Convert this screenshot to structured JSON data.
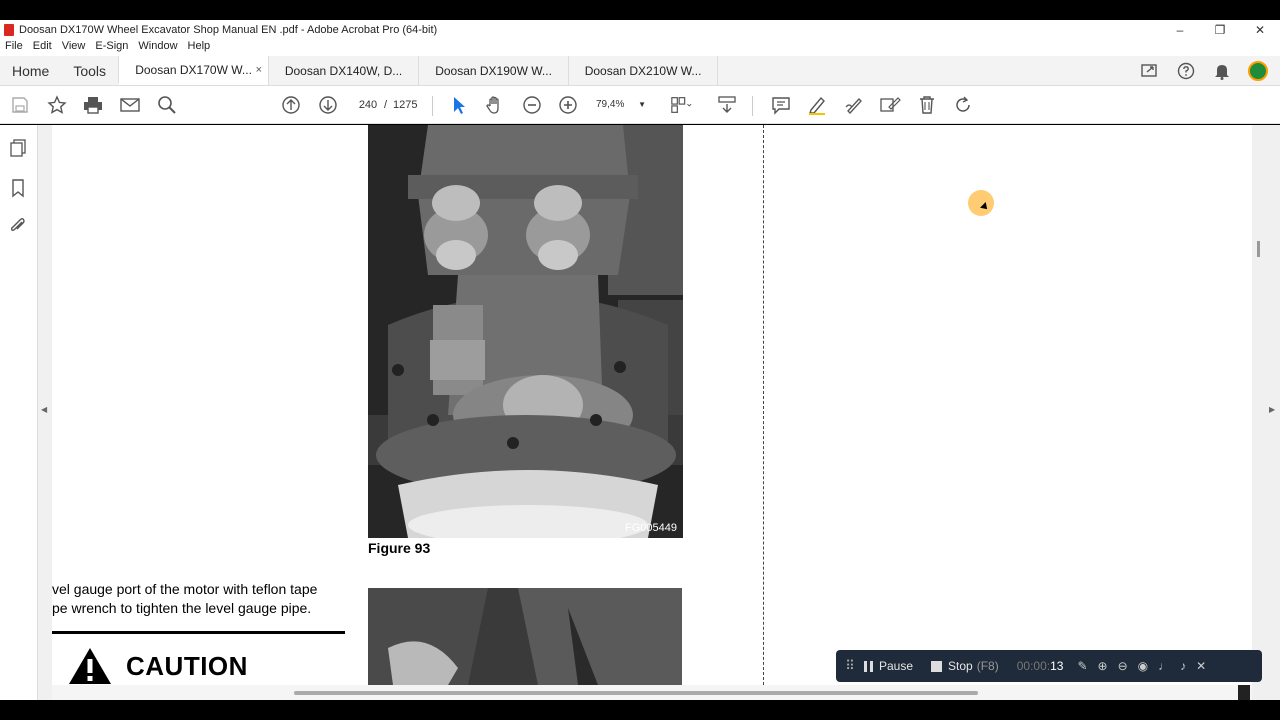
{
  "window": {
    "title": "Doosan DX170W Wheel Excavator Shop Manual EN .pdf - Adobe Acrobat Pro (64-bit)",
    "controls": [
      "–",
      "❐",
      "✕"
    ]
  },
  "menu": [
    "File",
    "Edit",
    "View",
    "E-Sign",
    "Window",
    "Help"
  ],
  "tabs": {
    "home": "Home",
    "tools": "Tools",
    "documents": [
      {
        "label": "Doosan DX170W W...",
        "active": true,
        "close": "×"
      },
      {
        "label": "Doosan DX140W, D..."
      },
      {
        "label": "Doosan DX190W W..."
      },
      {
        "label": "Doosan DX210W W..."
      }
    ]
  },
  "toolbar": {
    "current_page": "240",
    "page_sep": "/",
    "total_pages": "1275",
    "zoom": "79,4%"
  },
  "document": {
    "figure_label": "Figure 93",
    "figure_code": "FG005449",
    "body_lines": [
      "vel gauge port of the motor with teflon tape",
      "pe wrench to tighten the level gauge pipe."
    ],
    "caution": "CAUTION"
  },
  "recorder": {
    "pause_label": "Pause",
    "stop_label": "Stop",
    "stop_key": "(F8)",
    "timer_prefix": "00:00:",
    "timer_seconds": "13"
  },
  "colors": {
    "accent_blue": "#1a73e8",
    "recorder_bg": "#1f2a3a",
    "pdf_red": "#d8281f"
  }
}
